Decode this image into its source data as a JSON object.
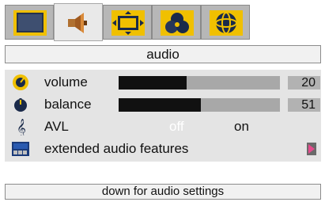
{
  "tabs": [
    {
      "icon": "picture-icon",
      "active": false
    },
    {
      "icon": "speaker-icon",
      "active": true
    },
    {
      "icon": "screen-format-icon",
      "active": false
    },
    {
      "icon": "color-circles-icon",
      "active": false
    },
    {
      "icon": "globe-icon",
      "active": false
    }
  ],
  "title": "audio",
  "menu": {
    "volume": {
      "label": "volume",
      "value": "20",
      "level_percent": 42
    },
    "balance": {
      "label": "balance",
      "value": "51",
      "level_percent": 51
    },
    "avl": {
      "label": "AVL",
      "option_off": "off",
      "option_on": "on",
      "selected": "off"
    },
    "extended": {
      "label": "extended audio features"
    }
  },
  "hint": "down for audio settings",
  "colors": {
    "accent": "#f0c000",
    "icon_dark": "#1a2a4a",
    "active_option": "#ffffff"
  }
}
